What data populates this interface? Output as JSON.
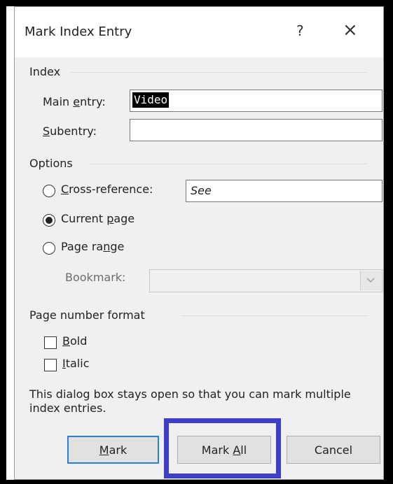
{
  "dialog": {
    "title": "Mark Index Entry",
    "help_symbol": "?",
    "close_symbol": "×"
  },
  "index": {
    "section_label": "Index",
    "main_entry": {
      "label_pre": "Main ",
      "label_key": "e",
      "label_post": "ntry:",
      "value": "Video"
    },
    "subentry": {
      "label_key": "S",
      "label_post": "ubentry:",
      "value": ""
    }
  },
  "options": {
    "section_label": "Options",
    "cross_reference": {
      "label_key": "C",
      "label_post": "ross-reference:",
      "value": "See",
      "selected": false
    },
    "current_page": {
      "label_pre": "Current ",
      "label_key": "p",
      "label_post": "age",
      "selected": true
    },
    "page_range": {
      "label_pre": "Page ra",
      "label_key": "n",
      "label_post": "ge",
      "selected": false
    },
    "bookmark": {
      "label": "Bookmark:",
      "value": "",
      "enabled": false
    }
  },
  "page_number_format": {
    "section_label": "Page number format",
    "bold": {
      "label_key": "B",
      "label_post": "old",
      "checked": false
    },
    "italic": {
      "label_key": "I",
      "label_post": "talic",
      "checked": false
    }
  },
  "note": "This dialog box stays open so that you can mark multiple index entries.",
  "buttons": {
    "mark": {
      "label_key": "M",
      "label_post": "ark"
    },
    "mark_all": {
      "label_pre": "Mark ",
      "label_key": "A",
      "label_post": "ll"
    },
    "cancel": {
      "label": "Cancel"
    }
  },
  "colors": {
    "highlight": "#3f3fc6",
    "default_button_border": "#2b7fd8",
    "dialog_bg": "#f0f0f0"
  }
}
